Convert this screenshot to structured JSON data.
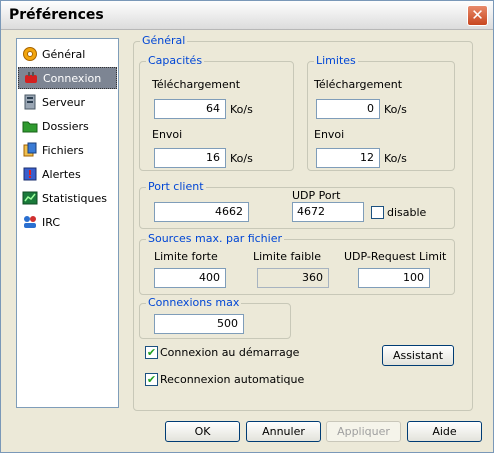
{
  "window": {
    "title": "Préférences",
    "close_symbol": "✕"
  },
  "sidebar": {
    "items": [
      {
        "label": "Général",
        "icon": "gear-icon",
        "selected": false
      },
      {
        "label": "Connexion",
        "icon": "network-plug-icon",
        "selected": true
      },
      {
        "label": "Serveur",
        "icon": "server-icon",
        "selected": false
      },
      {
        "label": "Dossiers",
        "icon": "folder-icon",
        "selected": false
      },
      {
        "label": "Fichiers",
        "icon": "files-icon",
        "selected": false
      },
      {
        "label": "Alertes",
        "icon": "alert-icon",
        "selected": false
      },
      {
        "label": "Statistiques",
        "icon": "chart-icon",
        "selected": false
      },
      {
        "label": "IRC",
        "icon": "irc-icon",
        "selected": false
      }
    ]
  },
  "general_section": {
    "legend": "Général"
  },
  "capacites": {
    "legend": "Capacités",
    "download_label": "Téléchargement",
    "download_value": "64",
    "upload_label": "Envoi",
    "upload_value": "16",
    "unit": "Ko/s"
  },
  "limites": {
    "legend": "Limites",
    "download_label": "Téléchargement",
    "download_value": "0",
    "upload_label": "Envoi",
    "upload_value": "12",
    "unit": "Ko/s"
  },
  "port_client": {
    "legend": "Port client",
    "tcp_value": "4662",
    "udp_label": "UDP Port",
    "udp_value": "4672",
    "disable_label": "disable",
    "disable_checked": false
  },
  "sources": {
    "legend": "Sources max. par fichier",
    "hard_label": "Limite forte",
    "hard_value": "400",
    "soft_label": "Limite faible",
    "soft_value": "360",
    "udp_label": "UDP-Request Limit",
    "udp_value": "100"
  },
  "connexions": {
    "legend": "Connexions max",
    "value": "500"
  },
  "options": {
    "connect_startup_label": "Connexion au démarrage",
    "connect_startup_checked": true,
    "reconnect_label": "Reconnexion automatique",
    "reconnect_checked": true,
    "check_symbol": "✔"
  },
  "assistant_label": "Assistant",
  "footer": {
    "ok": "OK",
    "cancel": "Annuler",
    "apply": "Appliquer",
    "help": "Aide"
  }
}
